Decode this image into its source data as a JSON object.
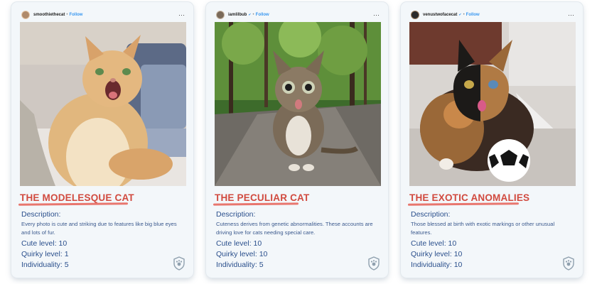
{
  "cards": [
    {
      "username": "smoothiethecat",
      "verified": false,
      "follow": "Follow",
      "title": "THE MODELESQUE CAT",
      "description_label": "Description:",
      "description": "Every photo is cute and striking due to features like big blue eyes and lots of fur.",
      "cute_label": "Cute level:",
      "cute": "10",
      "quirky_label": "Quirky level:",
      "quirky": "1",
      "individuality_label": "Individuality:",
      "individuality": "5"
    },
    {
      "username": "iamlilbub",
      "verified": true,
      "follow": "Follow",
      "title": "THE PECULIAR CAT",
      "description_label": "Description:",
      "description": "Cuteness derives from genetic abnormalities. These accounts are driving love for cats needing special care.",
      "cute_label": "Cute level:",
      "cute": "10",
      "quirky_label": "Quirky level:",
      "quirky": "10",
      "individuality_label": "Individuality:",
      "individuality": "5"
    },
    {
      "username": "venustwofacecat",
      "verified": true,
      "follow": "Follow",
      "title": "THE EXOTIC ANOMALIES",
      "description_label": "Description:",
      "description": "Those blessed at birth with exotic markings or other unusual features.",
      "cute_label": "Cute level:",
      "cute": "10",
      "quirky_label": "Quirky level:",
      "quirky": "10",
      "individuality_label": "Individuality:",
      "individuality": "10"
    }
  ],
  "colors": {
    "title": "#d14a3f",
    "underline": "#e8766e",
    "body_text": "#2a4f8c",
    "follow": "#3897f0",
    "card_bg": "#f3f7fa"
  },
  "icons": {
    "more": "more-options-icon",
    "verified": "verified-badge-icon",
    "badge": "cat-paw-badge-icon"
  }
}
